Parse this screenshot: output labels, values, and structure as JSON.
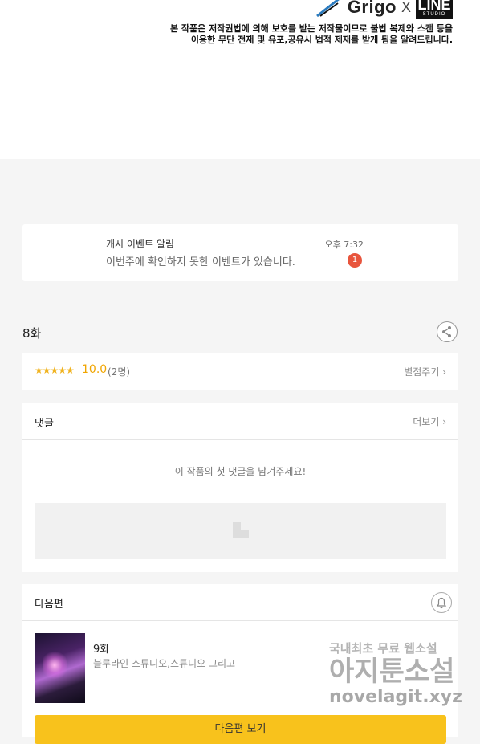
{
  "header": {
    "logo_grigo": "Grigo",
    "logo_x": "X",
    "logo_line": "LINE",
    "logo_line_sub": "STUDIO",
    "copyright_line1": "본 작품은 저작권법에 의해 보호를 받는 저작물이므로 불법 복제와 스캔 등을",
    "copyright_line2": "이용한 무단 전재 및 유포,공유시 법적 제재를 받게 됨을 알려드립니다."
  },
  "notification": {
    "title": "캐시 이벤트 알림",
    "message": "이번주에 확인하지 못한 이벤트가 있습니다.",
    "time": "오후 7:32",
    "badge": "1"
  },
  "episode": {
    "title": "8화"
  },
  "rating": {
    "stars": "★★★★★",
    "score": "10.0",
    "count": "(2명)",
    "rate_link": "별점주기 ›"
  },
  "comments": {
    "title": "댓글",
    "more": "더보기 ›",
    "empty_message": "이 작품의 첫 댓글을 남겨주세요!"
  },
  "next_episode": {
    "section_title": "다음편",
    "episode": "9화",
    "author": "블루라인 스튜디오,스튜디오 그리고",
    "button": "다음편 보기"
  },
  "watermark": {
    "line1": "국내최초 무료 웹소설",
    "line2": "아지툰소설",
    "line3": "novelagit.xyz"
  },
  "colors": {
    "accent": "#f8c21c",
    "rating": "#f0a500",
    "badge": "#e8553d"
  }
}
